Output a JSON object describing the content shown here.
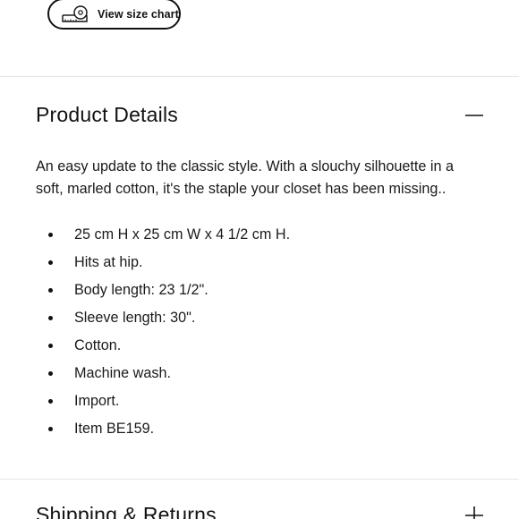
{
  "size_chart": {
    "label": "View size chart",
    "icon": "measuring-tape-icon"
  },
  "product_details": {
    "title": "Product Details",
    "toggle_icon": "minus-icon",
    "description": "An easy update to the classic style.  With a slouchy silhouette in a soft, marled cotton, it's the staple your closet has been missing..",
    "features": [
      "25 cm H x 25 cm W x 4 1/2 cm H.",
      "Hits at hip.",
      "Body length: 23 1/2\".",
      "Sleeve length: 30\".",
      "Cotton.",
      "Machine wash.",
      "Import.",
      "Item BE159."
    ]
  },
  "shipping_returns": {
    "title": "Shipping & Returns",
    "toggle_icon": "plus-icon"
  }
}
